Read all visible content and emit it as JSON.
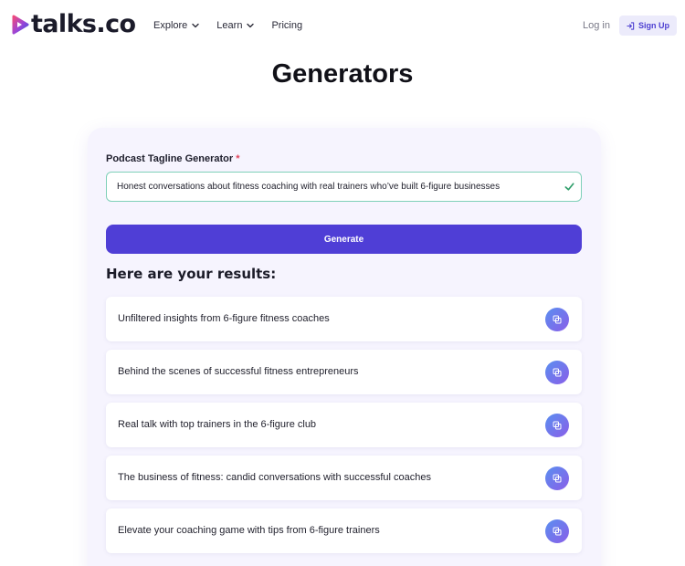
{
  "brand": {
    "name": "talks.co"
  },
  "nav": {
    "items": [
      {
        "label": "Explore",
        "has_dropdown": true
      },
      {
        "label": "Learn",
        "has_dropdown": true
      },
      {
        "label": "Pricing",
        "has_dropdown": false
      }
    ],
    "login_label": "Log in",
    "signup_label": "Sign Up"
  },
  "page": {
    "title": "Generators"
  },
  "form": {
    "label": "Podcast Tagline Generator",
    "required_marker": "*",
    "input_value": "Honest conversations about fitness coaching with real trainers who’ve built 6-figure businesses",
    "generate_label": "Generate"
  },
  "results": {
    "heading": "Here are your results:",
    "items": [
      "Unfiltered insights from 6-figure fitness coaches",
      "Behind the scenes of successful fitness entrepreneurs",
      "Real talk with top trainers in the 6-figure club",
      "The business of fitness: candid conversations with successful coaches",
      "Elevate your coaching game with tips from 6-figure trainers"
    ]
  },
  "colors": {
    "accent": "#4f3ed6",
    "card_bg": "#f6f4fe",
    "valid": "#2f9e6a",
    "required": "#e0435b"
  },
  "icons": {
    "brand": "talks-logo-icon",
    "dropdown": "chevron-down-icon",
    "signup": "sign-in-icon",
    "valid": "check-icon",
    "copy": "copy-icon"
  }
}
